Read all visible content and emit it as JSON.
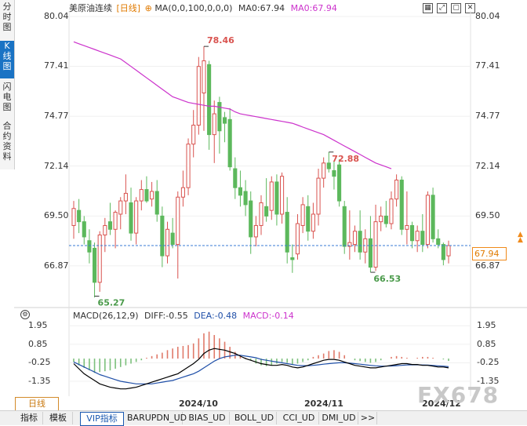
{
  "side_tabs": [
    {
      "label": "分时图",
      "active": false
    },
    {
      "label": "K线图",
      "active": true
    },
    {
      "label": "闪电图",
      "active": false
    },
    {
      "label": "合约资料",
      "active": false
    }
  ],
  "header": {
    "instrument": "美原油连续",
    "period_tag": "[日线]",
    "ma_settings": "MA(0,0,100,0,0,0)",
    "ma0_text": "MA0:67.94",
    "ma0_colored": "MA0:67.94"
  },
  "top_icons": [
    "grid-icon",
    "expand-icon",
    "restore-icon",
    "close-icon"
  ],
  "price_axis": {
    "ticks": [
      "80.04",
      "77.41",
      "74.77",
      "72.14",
      "69.50",
      "66.87"
    ]
  },
  "price_annotations": {
    "high": "78.46",
    "mid_high": "72.88",
    "low_left": "65.27",
    "low_right": "66.53"
  },
  "last_price": "67.94",
  "macd": {
    "header": "MACD(26,12,9)",
    "diff": "DIFF:-0.55",
    "dea": "DEA:-0.48",
    "macd": "MACD:-0.14",
    "ticks": [
      "1.95",
      "0.85",
      "-0.25",
      "-1.35"
    ]
  },
  "x_axis_labels": [
    "2024/10",
    "2024/11",
    "2024/12"
  ],
  "period_button": "日线",
  "bottom_tabs": [
    "指标",
    "模板",
    "VIP指标",
    "BARUPDN_UD",
    "BIAS_UD",
    "BOLL_UD",
    "CCI_UD",
    "DMI_UD",
    ">>"
  ],
  "watermark": "FX678",
  "colors": {
    "up": "#d9534f",
    "down": "#5cb85c",
    "ma": "#cc33cc",
    "diff": "#000000",
    "dea": "#1f4fa8",
    "macd_text": "#cc33cc",
    "accent": "#1a73c4",
    "flag": "#f08a1a"
  },
  "chart_data": {
    "type": "candlestick",
    "ylim": [
      65.0,
      80.04
    ],
    "candles": [
      {
        "o": 69.0,
        "h": 70.3,
        "l": 68.3,
        "c": 69.9
      },
      {
        "o": 69.8,
        "h": 70.4,
        "l": 68.6,
        "c": 69.2
      },
      {
        "o": 69.2,
        "h": 69.5,
        "l": 68.0,
        "c": 68.4
      },
      {
        "o": 68.2,
        "h": 68.8,
        "l": 67.0,
        "c": 67.6
      },
      {
        "o": 67.8,
        "h": 68.1,
        "l": 65.2,
        "c": 66.0
      },
      {
        "o": 66.0,
        "h": 68.7,
        "l": 65.5,
        "c": 68.5
      },
      {
        "o": 68.5,
        "h": 69.4,
        "l": 67.6,
        "c": 69.0
      },
      {
        "o": 69.2,
        "h": 70.2,
        "l": 68.5,
        "c": 68.8
      },
      {
        "o": 68.8,
        "h": 69.8,
        "l": 67.8,
        "c": 69.7
      },
      {
        "o": 69.6,
        "h": 70.5,
        "l": 68.8,
        "c": 70.3
      },
      {
        "o": 70.3,
        "h": 71.7,
        "l": 69.6,
        "c": 70.7
      },
      {
        "o": 70.2,
        "h": 71.0,
        "l": 68.2,
        "c": 68.6
      },
      {
        "o": 68.6,
        "h": 70.5,
        "l": 68.0,
        "c": 70.3
      },
      {
        "o": 70.3,
        "h": 71.4,
        "l": 69.8,
        "c": 70.9
      },
      {
        "o": 70.9,
        "h": 71.6,
        "l": 70.2,
        "c": 70.3
      },
      {
        "o": 70.4,
        "h": 71.3,
        "l": 70.0,
        "c": 70.8
      },
      {
        "o": 70.8,
        "h": 71.4,
        "l": 69.2,
        "c": 69.6
      },
      {
        "o": 69.5,
        "h": 70.0,
        "l": 66.8,
        "c": 67.4
      },
      {
        "o": 67.4,
        "h": 69.2,
        "l": 67.0,
        "c": 68.8
      },
      {
        "o": 68.6,
        "h": 69.4,
        "l": 67.8,
        "c": 68.0
      },
      {
        "o": 68.0,
        "h": 70.8,
        "l": 66.2,
        "c": 70.5
      },
      {
        "o": 70.5,
        "h": 71.9,
        "l": 70.0,
        "c": 71.0
      },
      {
        "o": 71.0,
        "h": 73.6,
        "l": 70.6,
        "c": 73.3
      },
      {
        "o": 73.3,
        "h": 75.1,
        "l": 72.6,
        "c": 74.3
      },
      {
        "o": 74.3,
        "h": 77.9,
        "l": 73.8,
        "c": 77.4
      },
      {
        "o": 76.0,
        "h": 78.46,
        "l": 74.0,
        "c": 77.7
      },
      {
        "o": 77.5,
        "h": 77.7,
        "l": 73.0,
        "c": 73.8
      },
      {
        "o": 73.8,
        "h": 75.6,
        "l": 72.3,
        "c": 74.9
      },
      {
        "o": 75.5,
        "h": 75.8,
        "l": 72.8,
        "c": 74.0
      },
      {
        "o": 74.7,
        "h": 75.0,
        "l": 73.4,
        "c": 74.4
      },
      {
        "o": 74.6,
        "h": 75.2,
        "l": 71.9,
        "c": 72.1
      },
      {
        "o": 72.0,
        "h": 72.6,
        "l": 70.4,
        "c": 71.0
      },
      {
        "o": 71.0,
        "h": 71.9,
        "l": 70.0,
        "c": 70.6
      },
      {
        "o": 70.8,
        "h": 71.4,
        "l": 69.5,
        "c": 70.1
      },
      {
        "o": 70.3,
        "h": 70.8,
        "l": 67.5,
        "c": 68.4
      },
      {
        "o": 68.4,
        "h": 69.5,
        "l": 67.9,
        "c": 69.0
      },
      {
        "o": 69.0,
        "h": 70.6,
        "l": 68.5,
        "c": 70.2
      },
      {
        "o": 70.0,
        "h": 71.5,
        "l": 69.2,
        "c": 69.5
      },
      {
        "o": 69.8,
        "h": 71.6,
        "l": 69.3,
        "c": 71.3
      },
      {
        "o": 71.3,
        "h": 71.7,
        "l": 69.0,
        "c": 69.6
      },
      {
        "o": 69.6,
        "h": 71.8,
        "l": 69.1,
        "c": 71.6
      },
      {
        "o": 69.7,
        "h": 70.5,
        "l": 67.0,
        "c": 67.6
      },
      {
        "o": 67.3,
        "h": 68.0,
        "l": 66.5,
        "c": 67.2
      },
      {
        "o": 67.5,
        "h": 69.6,
        "l": 67.2,
        "c": 69.1
      },
      {
        "o": 69.0,
        "h": 70.5,
        "l": 68.6,
        "c": 70.1
      },
      {
        "o": 70.0,
        "h": 70.6,
        "l": 68.2,
        "c": 68.7
      },
      {
        "o": 68.7,
        "h": 70.2,
        "l": 68.3,
        "c": 69.6
      },
      {
        "o": 69.6,
        "h": 72.0,
        "l": 69.0,
        "c": 71.5
      },
      {
        "o": 71.5,
        "h": 72.6,
        "l": 71.0,
        "c": 72.3
      },
      {
        "o": 72.3,
        "h": 72.88,
        "l": 71.8,
        "c": 72.0
      },
      {
        "o": 71.9,
        "h": 72.4,
        "l": 70.9,
        "c": 71.6
      },
      {
        "o": 72.2,
        "h": 72.5,
        "l": 70.0,
        "c": 70.3
      },
      {
        "o": 70.0,
        "h": 70.3,
        "l": 67.5,
        "c": 67.9
      },
      {
        "o": 67.9,
        "h": 69.8,
        "l": 67.2,
        "c": 68.1
      },
      {
        "o": 68.0,
        "h": 69.0,
        "l": 67.6,
        "c": 68.7
      },
      {
        "o": 68.7,
        "h": 69.8,
        "l": 67.2,
        "c": 67.6
      },
      {
        "o": 67.6,
        "h": 68.8,
        "l": 67.0,
        "c": 68.3
      },
      {
        "o": 68.3,
        "h": 69.5,
        "l": 66.53,
        "c": 66.8
      },
      {
        "o": 66.8,
        "h": 70.1,
        "l": 66.6,
        "c": 69.2
      },
      {
        "o": 69.2,
        "h": 70.0,
        "l": 68.7,
        "c": 69.5
      },
      {
        "o": 69.5,
        "h": 70.3,
        "l": 68.9,
        "c": 69.1
      },
      {
        "o": 69.1,
        "h": 70.8,
        "l": 68.8,
        "c": 70.4
      },
      {
        "o": 70.4,
        "h": 71.7,
        "l": 70.0,
        "c": 71.4
      },
      {
        "o": 71.4,
        "h": 71.6,
        "l": 68.5,
        "c": 68.8
      },
      {
        "o": 68.8,
        "h": 70.8,
        "l": 68.0,
        "c": 69.0
      },
      {
        "o": 69.0,
        "h": 69.2,
        "l": 67.8,
        "c": 68.2
      },
      {
        "o": 68.2,
        "h": 69.0,
        "l": 67.6,
        "c": 68.7
      },
      {
        "o": 68.7,
        "h": 69.6,
        "l": 67.6,
        "c": 68.0
      },
      {
        "o": 68.0,
        "h": 70.8,
        "l": 67.8,
        "c": 70.6
      },
      {
        "o": 70.6,
        "h": 71.0,
        "l": 68.1,
        "c": 68.3
      },
      {
        "o": 68.3,
        "h": 68.8,
        "l": 67.8,
        "c": 68.0
      },
      {
        "o": 68.0,
        "h": 68.1,
        "l": 66.9,
        "c": 67.2
      },
      {
        "o": 67.4,
        "h": 68.2,
        "l": 67.0,
        "c": 67.94
      }
    ],
    "ma_series": {
      "name": "MA0",
      "values": [
        78.7,
        78.6,
        78.5,
        78.4,
        78.3,
        78.2,
        78.1,
        78.0,
        77.9,
        77.8,
        77.6,
        77.4,
        77.2,
        77.0,
        76.8,
        76.6,
        76.4,
        76.2,
        76.0,
        75.8,
        75.7,
        75.6,
        75.5,
        75.45,
        75.4,
        75.35,
        75.3,
        75.3,
        75.25,
        75.2,
        75.15,
        75.0,
        74.9,
        74.85,
        74.8,
        74.75,
        74.7,
        74.65,
        74.6,
        74.55,
        74.5,
        74.45,
        74.4,
        74.3,
        74.2,
        74.1,
        74.0,
        73.9,
        73.8,
        73.65,
        73.5,
        73.35,
        73.2,
        73.05,
        72.9,
        72.75,
        72.6,
        72.45,
        72.3,
        72.2,
        72.1,
        72.0
      ]
    },
    "ma_start_index": 0,
    "macd_ylim": [
      -2.0,
      2.1
    ],
    "macd_hist": [
      -0.2,
      -0.4,
      -0.55,
      -0.7,
      -0.85,
      -0.8,
      -0.75,
      -0.7,
      -0.6,
      -0.5,
      -0.4,
      -0.3,
      -0.2,
      -0.1,
      0.05,
      0.15,
      0.25,
      0.35,
      0.5,
      0.6,
      0.7,
      0.75,
      0.8,
      0.9,
      1.2,
      1.5,
      1.6,
      1.4,
      1.2,
      1.0,
      0.7,
      0.4,
      0.2,
      0.05,
      -0.1,
      -0.3,
      -0.4,
      -0.45,
      -0.4,
      -0.3,
      -0.2,
      -0.25,
      -0.35,
      -0.3,
      -0.2,
      -0.1,
      0.1,
      0.2,
      0.3,
      0.45,
      0.5,
      0.4,
      0.2,
      0.0,
      -0.1,
      -0.15,
      -0.2,
      -0.25,
      -0.2,
      -0.1,
      0.0,
      0.1,
      0.15,
      0.1,
      0.05,
      0.0,
      0.05,
      0.1,
      0.1,
      0.05,
      0.0,
      -0.05,
      -0.14
    ],
    "diff": [
      -0.3,
      -0.6,
      -0.9,
      -1.1,
      -1.3,
      -1.5,
      -1.6,
      -1.7,
      -1.75,
      -1.8,
      -1.8,
      -1.75,
      -1.7,
      -1.6,
      -1.5,
      -1.4,
      -1.3,
      -1.2,
      -1.1,
      -1.0,
      -0.9,
      -0.7,
      -0.5,
      -0.3,
      -0.05,
      0.3,
      0.5,
      0.6,
      0.55,
      0.5,
      0.4,
      0.3,
      0.15,
      0.0,
      -0.1,
      -0.2,
      -0.3,
      -0.35,
      -0.4,
      -0.4,
      -0.35,
      -0.4,
      -0.5,
      -0.55,
      -0.5,
      -0.4,
      -0.3,
      -0.2,
      -0.1,
      -0.05,
      -0.05,
      -0.1,
      -0.2,
      -0.3,
      -0.4,
      -0.45,
      -0.5,
      -0.55,
      -0.55,
      -0.5,
      -0.45,
      -0.4,
      -0.35,
      -0.3,
      -0.3,
      -0.35,
      -0.35,
      -0.4,
      -0.4,
      -0.45,
      -0.5,
      -0.5,
      -0.55
    ],
    "dea": [
      -0.2,
      -0.35,
      -0.5,
      -0.65,
      -0.8,
      -0.95,
      -1.05,
      -1.15,
      -1.25,
      -1.35,
      -1.4,
      -1.45,
      -1.5,
      -1.5,
      -1.5,
      -1.5,
      -1.45,
      -1.4,
      -1.35,
      -1.3,
      -1.2,
      -1.1,
      -1.0,
      -0.9,
      -0.75,
      -0.55,
      -0.35,
      -0.15,
      0.0,
      0.1,
      0.15,
      0.2,
      0.2,
      0.15,
      0.1,
      0.05,
      -0.05,
      -0.1,
      -0.15,
      -0.2,
      -0.25,
      -0.3,
      -0.35,
      -0.4,
      -0.42,
      -0.42,
      -0.4,
      -0.37,
      -0.33,
      -0.3,
      -0.27,
      -0.25,
      -0.25,
      -0.27,
      -0.3,
      -0.33,
      -0.37,
      -0.4,
      -0.43,
      -0.45,
      -0.45,
      -0.44,
      -0.42,
      -0.4,
      -0.38,
      -0.37,
      -0.37,
      -0.38,
      -0.39,
      -0.41,
      -0.43,
      -0.45,
      -0.48
    ]
  }
}
